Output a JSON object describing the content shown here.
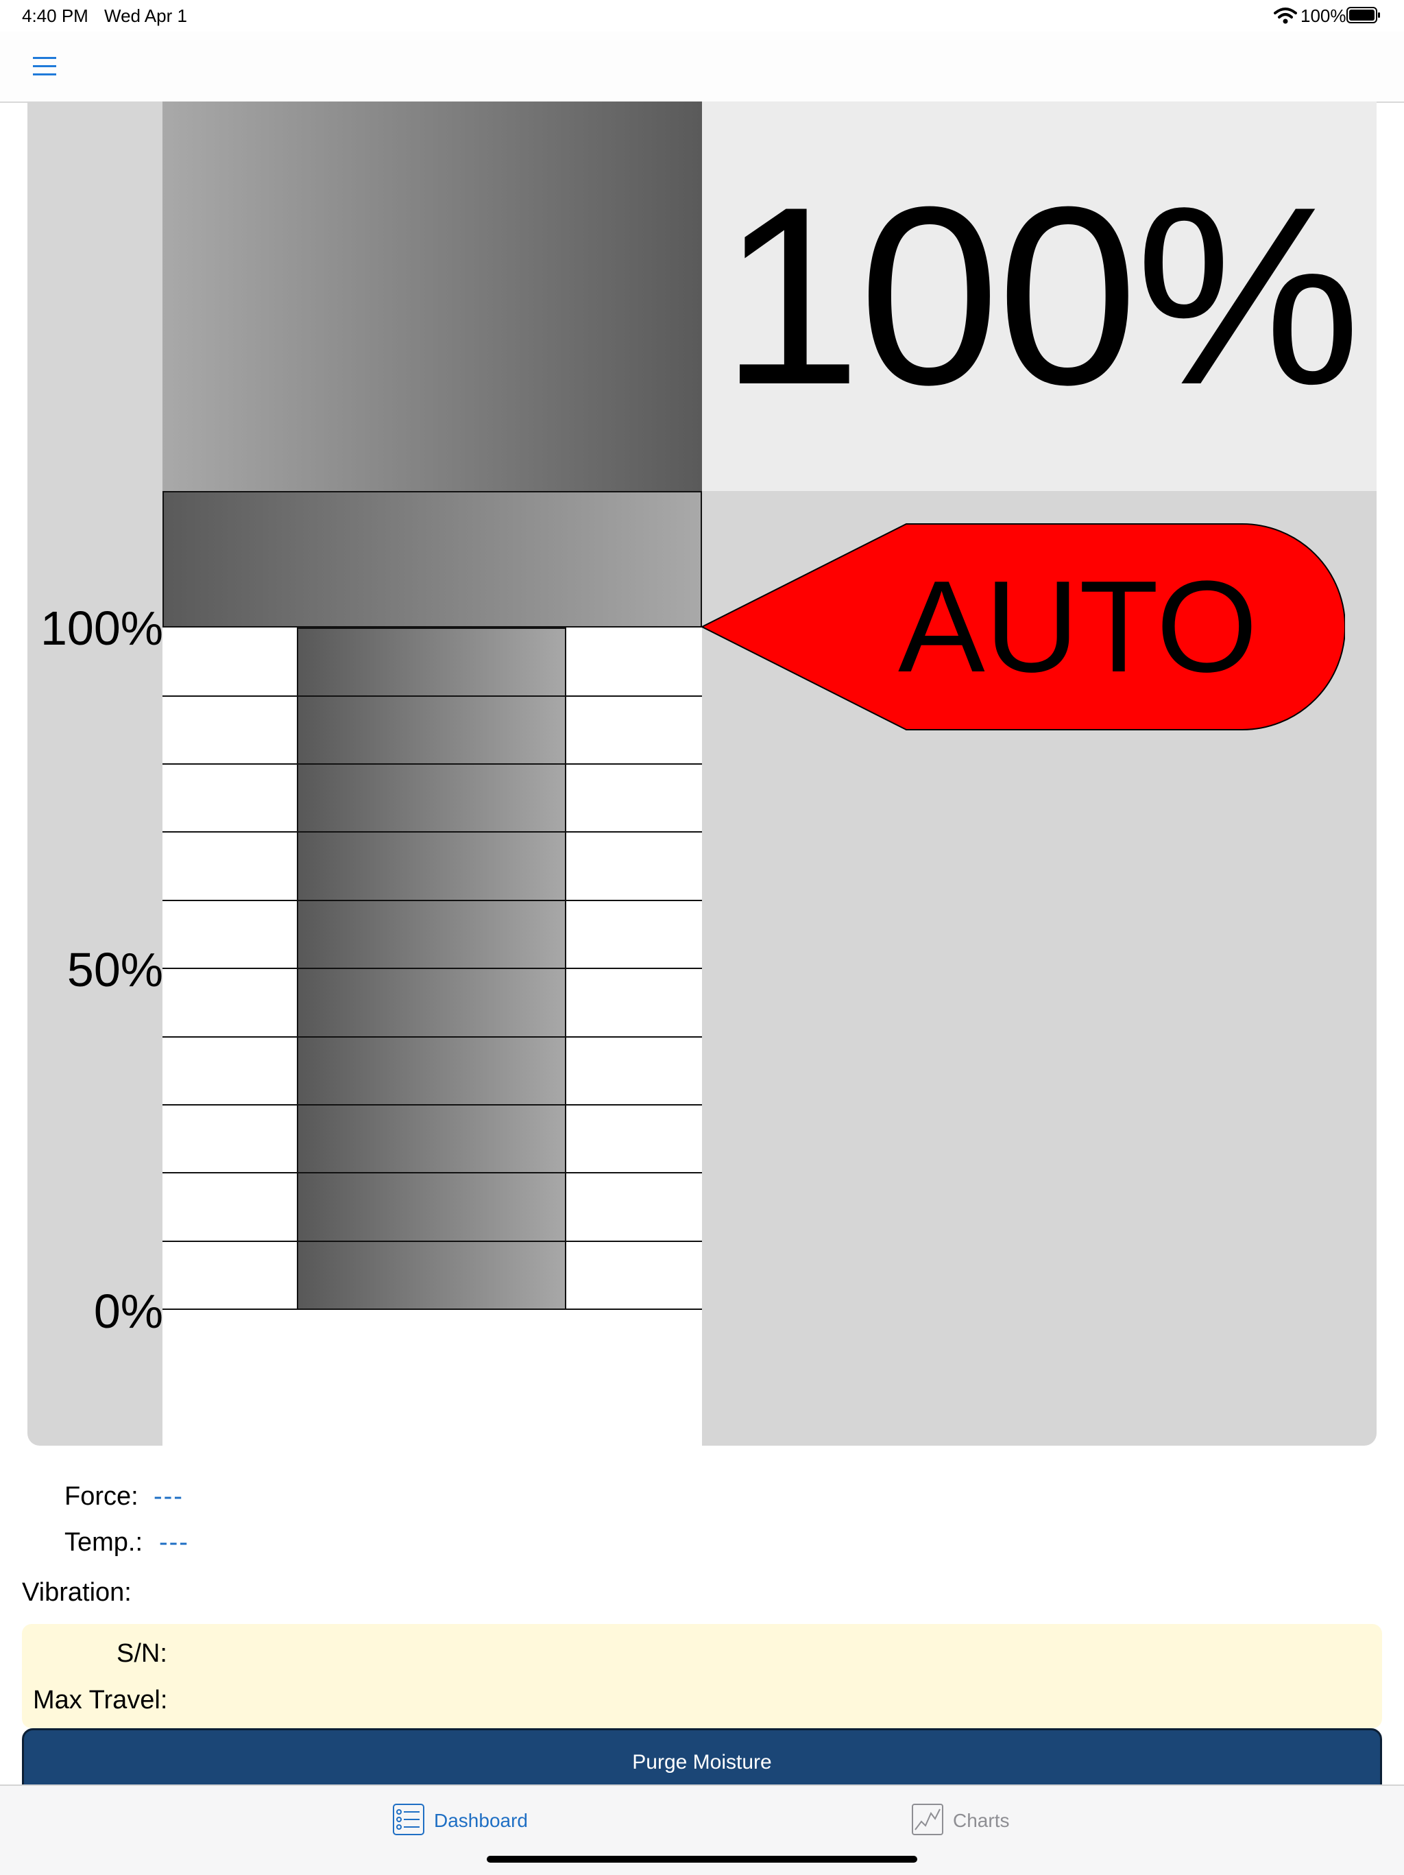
{
  "status_bar": {
    "time": "4:40 PM",
    "date": "Wed Apr 1",
    "battery_percent": "100%",
    "battery_level": 1.0
  },
  "navbar": {
    "menu_icon": "hamburger-menu-icon",
    "accent_color": "#1f7ad9"
  },
  "gauge": {
    "position_percent": "100%",
    "position_value": 100,
    "mode": "AUTO",
    "mode_color": "#ff0000",
    "axis_labels": {
      "top": "100%",
      "middle": "50%",
      "bottom": "0%"
    }
  },
  "readouts": {
    "force_label": "Force:",
    "force_value": "---",
    "temp_label": "Temp.:",
    "temp_value": "---",
    "vibration_label": "Vibration:"
  },
  "info": {
    "sn_label": "S/N:",
    "max_travel_label": "Max Travel:"
  },
  "actions": {
    "purge_label": "Purge Moisture"
  },
  "tabs": [
    {
      "label": "Dashboard",
      "icon": "dashboard-list-icon",
      "active": true
    },
    {
      "label": "Charts",
      "icon": "chart-icon",
      "active": false
    }
  ]
}
